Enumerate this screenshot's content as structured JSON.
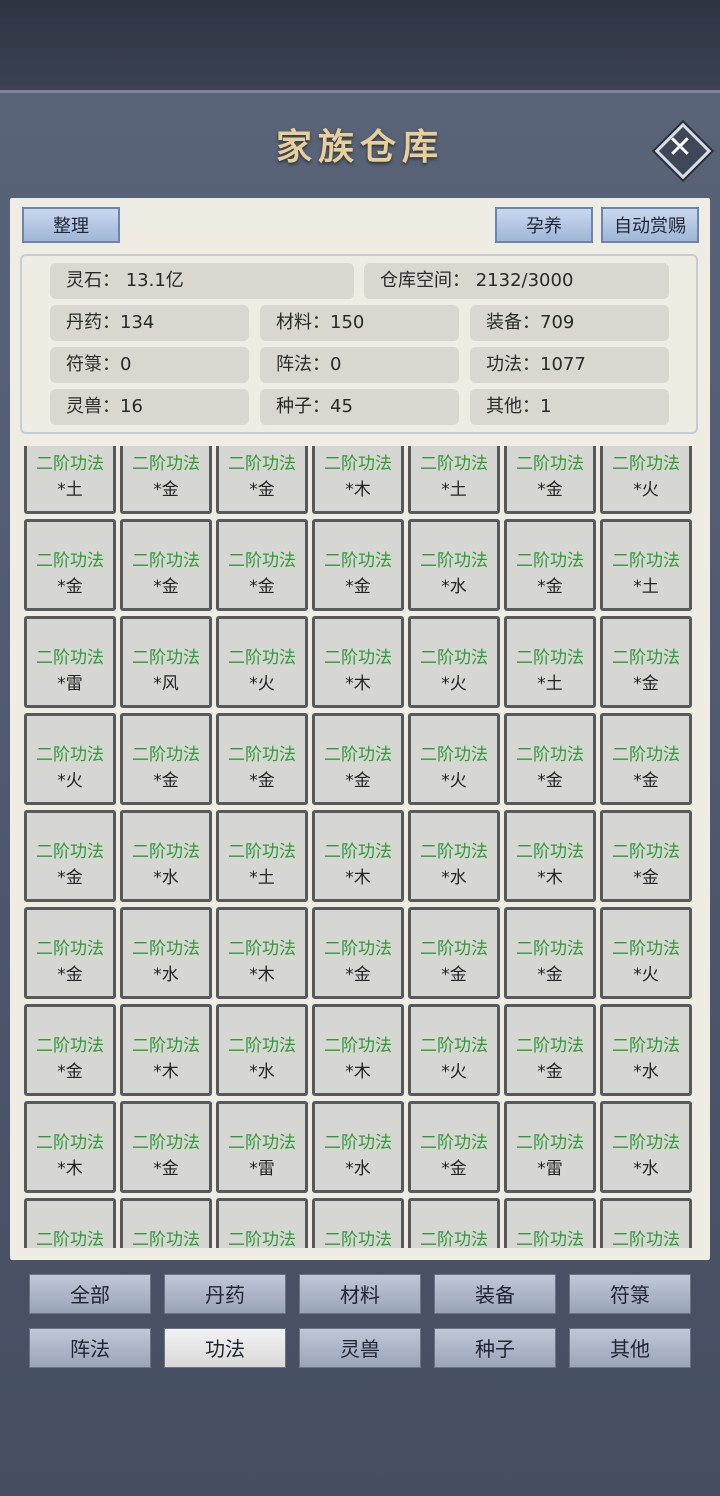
{
  "title": "家族仓库",
  "buttons": {
    "sort": "整理",
    "nurture": "孕养",
    "auto_reward": "自动赏赐"
  },
  "stats": {
    "spirit_stones": "灵石：  13.1亿",
    "capacity": "仓库空间：    2132/3000",
    "pills": "丹药：134",
    "materials": "材料：150",
    "equipment": "装备：709",
    "talismans": "符箓：0",
    "formations": "阵法：0",
    "techniques": "功法：1077",
    "beasts": "灵兽：16",
    "seeds": "种子：45",
    "others": "其他：1"
  },
  "items": [
    {
      "name": "二阶功法",
      "element": "*土"
    },
    {
      "name": "二阶功法",
      "element": "*金"
    },
    {
      "name": "二阶功法",
      "element": "*金"
    },
    {
      "name": "二阶功法",
      "element": "*木"
    },
    {
      "name": "二阶功法",
      "element": "*土"
    },
    {
      "name": "二阶功法",
      "element": "*金"
    },
    {
      "name": "二阶功法",
      "element": "*火"
    },
    {
      "name": "二阶功法",
      "element": "*金"
    },
    {
      "name": "二阶功法",
      "element": "*金"
    },
    {
      "name": "二阶功法",
      "element": "*金"
    },
    {
      "name": "二阶功法",
      "element": "*金"
    },
    {
      "name": "二阶功法",
      "element": "*水"
    },
    {
      "name": "二阶功法",
      "element": "*金"
    },
    {
      "name": "二阶功法",
      "element": "*土"
    },
    {
      "name": "二阶功法",
      "element": "*雷"
    },
    {
      "name": "二阶功法",
      "element": "*风"
    },
    {
      "name": "二阶功法",
      "element": "*火"
    },
    {
      "name": "二阶功法",
      "element": "*木"
    },
    {
      "name": "二阶功法",
      "element": "*火"
    },
    {
      "name": "二阶功法",
      "element": "*土"
    },
    {
      "name": "二阶功法",
      "element": "*金"
    },
    {
      "name": "二阶功法",
      "element": "*火"
    },
    {
      "name": "二阶功法",
      "element": "*金"
    },
    {
      "name": "二阶功法",
      "element": "*金"
    },
    {
      "name": "二阶功法",
      "element": "*金"
    },
    {
      "name": "二阶功法",
      "element": "*火"
    },
    {
      "name": "二阶功法",
      "element": "*金"
    },
    {
      "name": "二阶功法",
      "element": "*金"
    },
    {
      "name": "二阶功法",
      "element": "*金"
    },
    {
      "name": "二阶功法",
      "element": "*水"
    },
    {
      "name": "二阶功法",
      "element": "*土"
    },
    {
      "name": "二阶功法",
      "element": "*木"
    },
    {
      "name": "二阶功法",
      "element": "*水"
    },
    {
      "name": "二阶功法",
      "element": "*木"
    },
    {
      "name": "二阶功法",
      "element": "*金"
    },
    {
      "name": "二阶功法",
      "element": "*金"
    },
    {
      "name": "二阶功法",
      "element": "*水"
    },
    {
      "name": "二阶功法",
      "element": "*木"
    },
    {
      "name": "二阶功法",
      "element": "*金"
    },
    {
      "name": "二阶功法",
      "element": "*金"
    },
    {
      "name": "二阶功法",
      "element": "*金"
    },
    {
      "name": "二阶功法",
      "element": "*火"
    },
    {
      "name": "二阶功法",
      "element": "*金"
    },
    {
      "name": "二阶功法",
      "element": "*木"
    },
    {
      "name": "二阶功法",
      "element": "*水"
    },
    {
      "name": "二阶功法",
      "element": "*木"
    },
    {
      "name": "二阶功法",
      "element": "*火"
    },
    {
      "name": "二阶功法",
      "element": "*金"
    },
    {
      "name": "二阶功法",
      "element": "*水"
    },
    {
      "name": "二阶功法",
      "element": "*木"
    },
    {
      "name": "二阶功法",
      "element": "*金"
    },
    {
      "name": "二阶功法",
      "element": "*雷"
    },
    {
      "name": "二阶功法",
      "element": "*水"
    },
    {
      "name": "二阶功法",
      "element": "*金"
    },
    {
      "name": "二阶功法",
      "element": "*雷"
    },
    {
      "name": "二阶功法",
      "element": "*水"
    },
    {
      "name": "二阶功法",
      "element": ""
    },
    {
      "name": "二阶功法",
      "element": ""
    },
    {
      "name": "二阶功法",
      "element": ""
    },
    {
      "name": "二阶功法",
      "element": ""
    },
    {
      "name": "二阶功法",
      "element": ""
    },
    {
      "name": "二阶功法",
      "element": ""
    },
    {
      "name": "二阶功法",
      "element": ""
    }
  ],
  "tabs": [
    "全部",
    "丹药",
    "材料",
    "装备",
    "符箓",
    "阵法",
    "功法",
    "灵兽",
    "种子",
    "其他"
  ],
  "active_tab": "功法",
  "colors": {
    "item_name": "#2f9a35",
    "title": "#e6cf9a"
  }
}
